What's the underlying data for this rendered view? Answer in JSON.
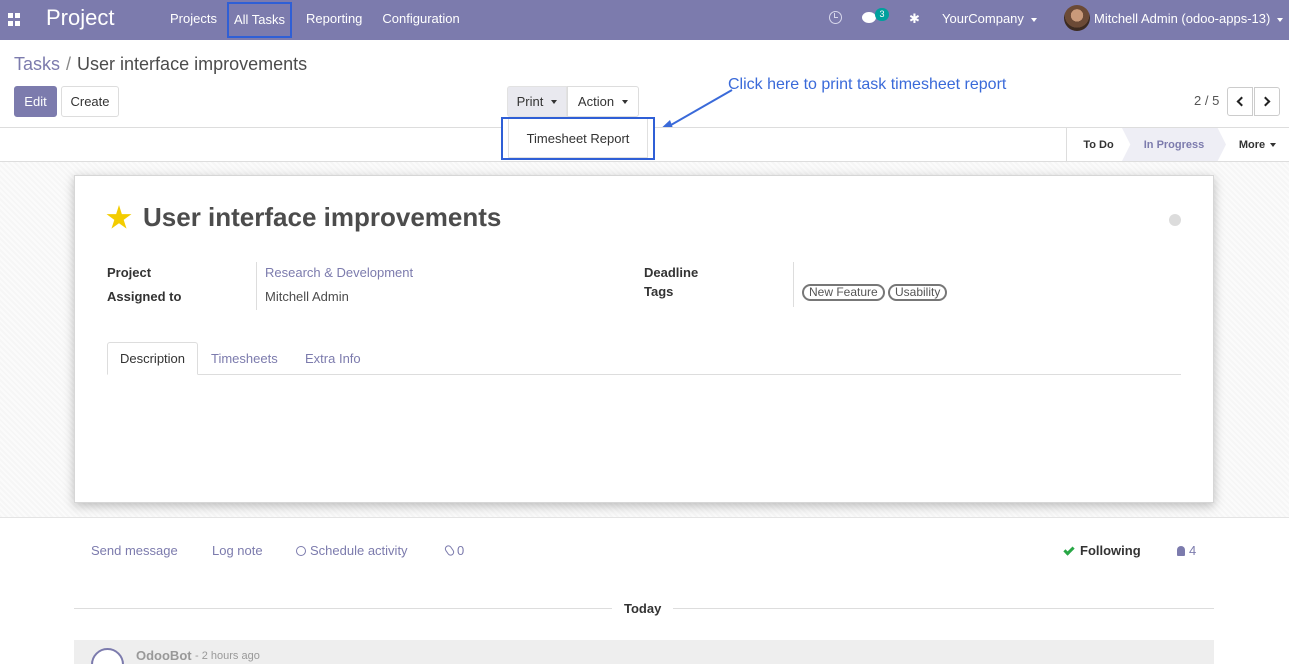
{
  "navbar": {
    "app_name": "Project",
    "menu": [
      "Projects",
      "All Tasks",
      "Reporting",
      "Configuration"
    ],
    "chat_badge": "3",
    "company": "YourCompany",
    "user": "Mitchell Admin (odoo-apps-13)"
  },
  "breadcrumb": {
    "parent": "Tasks",
    "separator": "/",
    "current": "User interface improvements"
  },
  "buttons": {
    "edit": "Edit",
    "create": "Create",
    "print": "Print",
    "action": "Action"
  },
  "print_menu": {
    "items": [
      "Timesheet Report"
    ]
  },
  "annotation": "Click here to print task timesheet report",
  "pager": {
    "value": "2 / 5"
  },
  "stages": {
    "todo": "To Do",
    "in_progress": "In Progress",
    "more": "More"
  },
  "task": {
    "title": "User interface improvements",
    "project_label": "Project",
    "project_value": "Research & Development",
    "assigned_label": "Assigned to",
    "assigned_value": "Mitchell Admin",
    "deadline_label": "Deadline",
    "tags_label": "Tags",
    "tags": [
      "New Feature",
      "Usability"
    ]
  },
  "tabs": [
    "Description",
    "Timesheets",
    "Extra Info"
  ],
  "chatter": {
    "send_message": "Send message",
    "log_note": "Log note",
    "schedule_activity": "Schedule activity",
    "attachments": "0",
    "following": "Following",
    "followers": "4",
    "day": "Today",
    "message_author": "OdooBot",
    "message_time": "- 2 hours ago"
  },
  "colors": {
    "brand": "#7c7bad",
    "highlight": "#2f5fd6",
    "star": "#f3cc00"
  }
}
